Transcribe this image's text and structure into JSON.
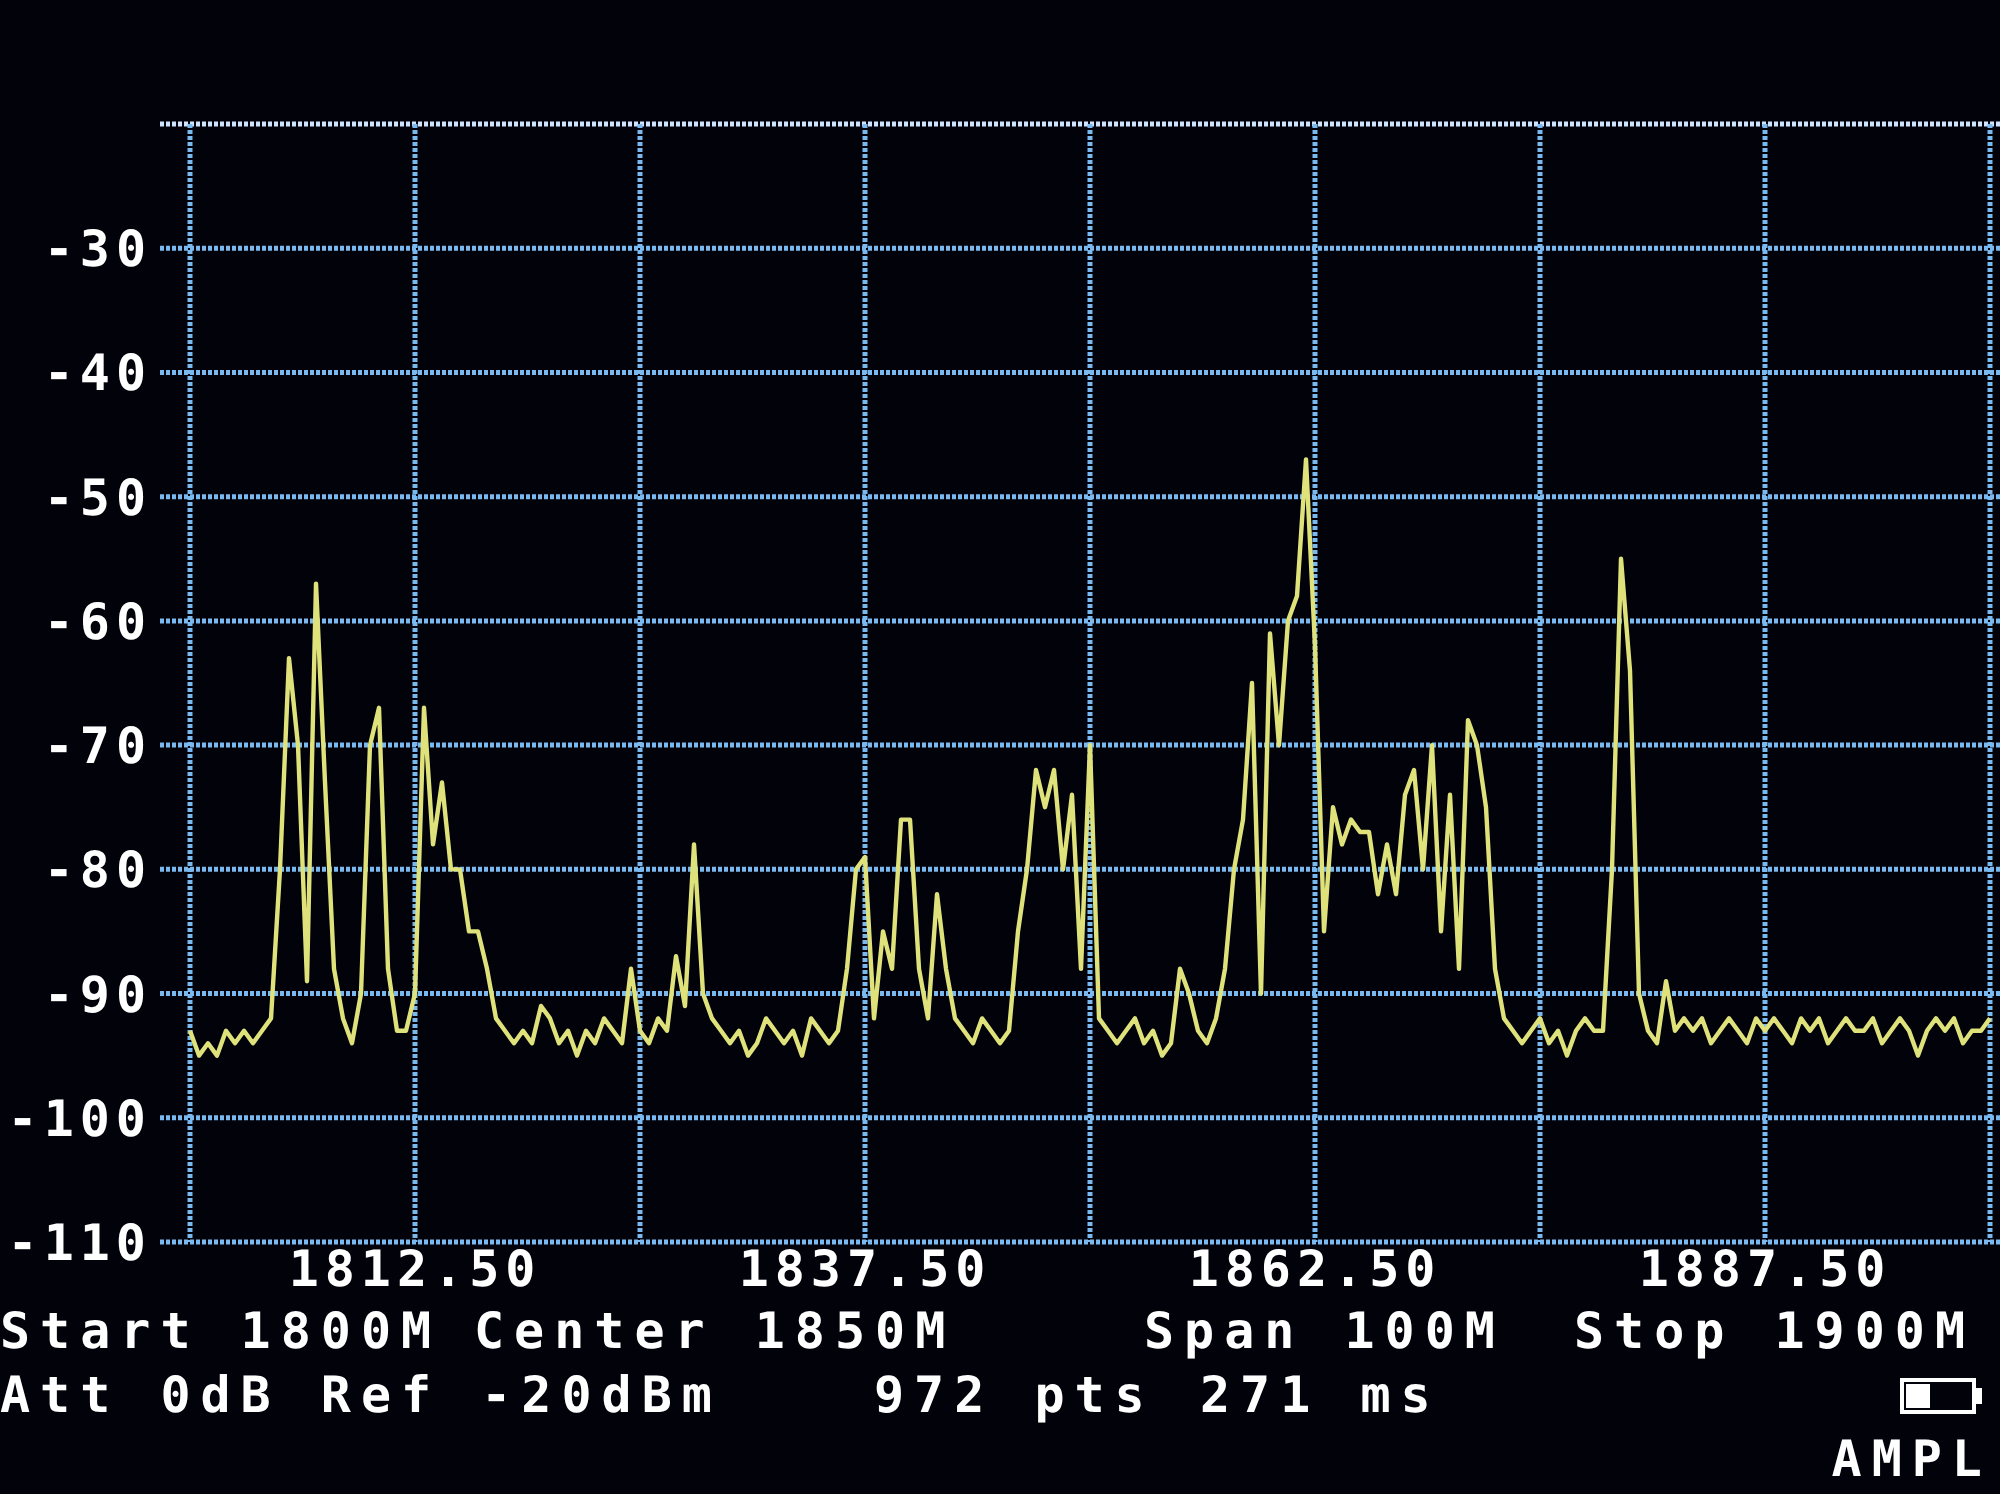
{
  "plot": {
    "chart_data": {
      "type": "line",
      "xlim": [
        1800,
        1900
      ],
      "ylim": [
        -110,
        -20
      ],
      "xticks": [
        {
          "value": 1812.5,
          "label": "1812.50"
        },
        {
          "value": 1837.5,
          "label": "1837.50"
        },
        {
          "value": 1862.5,
          "label": "1862.50"
        },
        {
          "value": 1887.5,
          "label": "1887.50"
        }
      ],
      "yticks": [
        -30,
        -40,
        -50,
        -60,
        -70,
        -80,
        -90,
        -100,
        -110
      ],
      "grid": true,
      "x": [
        1800,
        1800.5,
        1801,
        1801.5,
        1802,
        1802.5,
        1803,
        1803.5,
        1804,
        1804.5,
        1805,
        1805.5,
        1806,
        1806.5,
        1807,
        1807.5,
        1808,
        1808.5,
        1809,
        1809.5,
        1810,
        1810.5,
        1811,
        1811.5,
        1812,
        1812.5,
        1813,
        1813.5,
        1814,
        1814.5,
        1815,
        1815.5,
        1816,
        1816.5,
        1817,
        1817.5,
        1818,
        1818.5,
        1819,
        1819.5,
        1820,
        1820.5,
        1821,
        1821.5,
        1822,
        1822.5,
        1823,
        1823.5,
        1824,
        1824.5,
        1825,
        1825.5,
        1826,
        1826.5,
        1827,
        1827.5,
        1828,
        1828.5,
        1829,
        1829.5,
        1830,
        1830.5,
        1831,
        1831.5,
        1832,
        1832.5,
        1833,
        1833.5,
        1834,
        1834.5,
        1835,
        1835.5,
        1836,
        1836.5,
        1837,
        1837.5,
        1838,
        1838.5,
        1839,
        1839.5,
        1840,
        1840.5,
        1841,
        1841.5,
        1842,
        1842.5,
        1843,
        1843.5,
        1844,
        1844.5,
        1845,
        1845.5,
        1846,
        1846.5,
        1847,
        1847.5,
        1848,
        1848.5,
        1849,
        1849.5,
        1850,
        1850.5,
        1851,
        1851.5,
        1852,
        1852.5,
        1853,
        1853.5,
        1854,
        1854.5,
        1855,
        1855.5,
        1856,
        1856.5,
        1857,
        1857.5,
        1858,
        1858.5,
        1859,
        1859.5,
        1860,
        1860.5,
        1861,
        1861.5,
        1862,
        1862.5,
        1863,
        1863.5,
        1864,
        1864.5,
        1865,
        1865.5,
        1866,
        1866.5,
        1867,
        1867.5,
        1868,
        1868.5,
        1869,
        1869.5,
        1870,
        1870.5,
        1871,
        1871.5,
        1872,
        1872.5,
        1873,
        1873.5,
        1874,
        1874.5,
        1875,
        1875.5,
        1876,
        1876.5,
        1877,
        1877.5,
        1878,
        1878.5,
        1879,
        1879.5,
        1880,
        1880.5,
        1881,
        1881.5,
        1882,
        1882.5,
        1883,
        1883.5,
        1884,
        1884.5,
        1885,
        1885.5,
        1886,
        1886.5,
        1887,
        1887.5,
        1888,
        1888.5,
        1889,
        1889.5,
        1890,
        1890.5,
        1891,
        1891.5,
        1892,
        1892.5,
        1893,
        1893.5,
        1894,
        1894.5,
        1895,
        1895.5,
        1896,
        1896.5,
        1897,
        1897.5,
        1898,
        1898.5,
        1899,
        1899.5,
        1900
      ],
      "series": [
        {
          "color": "#dfe27a",
          "values": [
            -93,
            -95,
            -94,
            -95,
            -93,
            -94,
            -93,
            -94,
            -93,
            -92,
            -80,
            -63,
            -70,
            -89,
            -57,
            -73,
            -88,
            -92,
            -94,
            -90,
            -70,
            -67,
            -88,
            -93,
            -93,
            -90,
            -67,
            -78,
            -73,
            -80,
            -80,
            -85,
            -85,
            -88,
            -92,
            -93,
            -94,
            -93,
            -94,
            -91,
            -92,
            -94,
            -93,
            -95,
            -93,
            -94,
            -92,
            -93,
            -94,
            -88,
            -93,
            -94,
            -92,
            -93,
            -87,
            -91,
            -78,
            -90,
            -92,
            -93,
            -94,
            -93,
            -95,
            -94,
            -92,
            -93,
            -94,
            -93,
            -95,
            -92,
            -93,
            -94,
            -93,
            -88,
            -80,
            -79,
            -92,
            -85,
            -88,
            -76,
            -76,
            -88,
            -92,
            -82,
            -88,
            -92,
            -93,
            -94,
            -92,
            -93,
            -94,
            -93,
            -85,
            -80,
            -72,
            -75,
            -72,
            -80,
            -74,
            -88,
            -70,
            -92,
            -93,
            -94,
            -93,
            -92,
            -94,
            -93,
            -95,
            -94,
            -88,
            -90,
            -93,
            -94,
            -92,
            -88,
            -80,
            -76,
            -65,
            -90,
            -61,
            -70,
            -60,
            -58,
            -47,
            -62,
            -85,
            -75,
            -78,
            -76,
            -77,
            -77,
            -82,
            -78,
            -82,
            -74,
            -72,
            -80,
            -70,
            -85,
            -74,
            -88,
            -68,
            -70,
            -75,
            -88,
            -92,
            -93,
            -94,
            -93,
            -92,
            -94,
            -93,
            -95,
            -93,
            -92,
            -93,
            -93,
            -80,
            -55,
            -64,
            -90,
            -93,
            -94,
            -89,
            -93,
            -92,
            -93,
            -92,
            -94,
            -93,
            -92,
            -93,
            -94,
            -92,
            -93,
            -92,
            -93,
            -94,
            -92,
            -93,
            -92,
            -94,
            -93,
            -92,
            -93,
            -93,
            -92,
            -94,
            -93,
            -92,
            -93,
            -95,
            -93,
            -92,
            -93,
            -92,
            -94,
            -93,
            -93,
            -92
          ]
        }
      ]
    }
  },
  "status": {
    "line_1": [
      "Start 1800M",
      "Center 1850M",
      "Span 100M",
      "Stop 1900M"
    ],
    "line_2": [
      "Att 0dB Ref -20dBm",
      "972 pts",
      "271 ms"
    ],
    "menu_label": "AMPL"
  }
}
